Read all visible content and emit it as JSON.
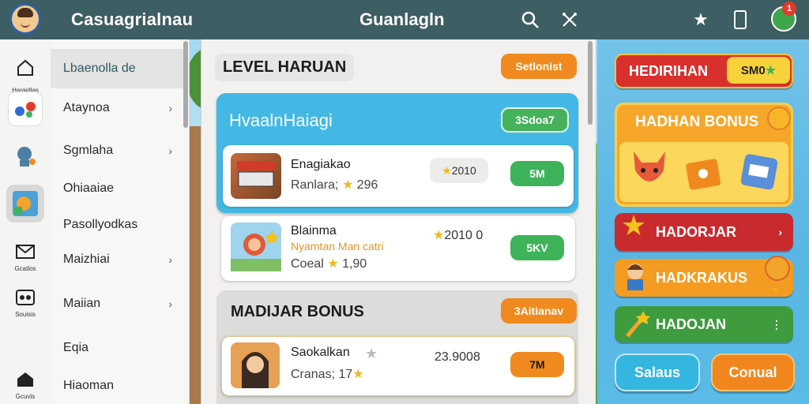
{
  "header": {
    "app_title": "Casuagrialnau",
    "center_title": "Guanlagln",
    "search_icon": "search-icon",
    "tools_icon": "crossed-tools-icon",
    "star_icon": "star-icon",
    "phone_icon": "phone-icon",
    "notification_badge": "1"
  },
  "rail": {
    "items": [
      {
        "icon": "home-icon",
        "label": "Haraidlas"
      },
      {
        "icon": "game-controller-icon",
        "label": ""
      },
      {
        "icon": "character-icon",
        "label": ""
      },
      {
        "icon": "map-icon",
        "label": ""
      },
      {
        "icon": "mail-icon",
        "label": "Gcatlos"
      },
      {
        "icon": "settings-icon",
        "label": "Souisis"
      },
      {
        "icon": "shop-icon",
        "label": "Gcuvis"
      }
    ]
  },
  "menu": {
    "items": [
      {
        "label": "Lbaenolla de",
        "chevron": false,
        "active": true
      },
      {
        "label": "Ataynoa",
        "chevron": true,
        "active": false
      },
      {
        "label": "Sgmlaha",
        "chevron": true,
        "active": false
      },
      {
        "label": "Ohiaaiae",
        "chevron": false,
        "active": false
      },
      {
        "label": "Pasollyodkas",
        "chevron": false,
        "active": false
      },
      {
        "label": "Maizhiai",
        "chevron": true,
        "active": false
      },
      {
        "label": "Maiian",
        "chevron": true,
        "active": false
      },
      {
        "label": "Eqia",
        "chevron": false,
        "active": false
      },
      {
        "label": "Hiaoman",
        "chevron": false,
        "active": false
      }
    ]
  },
  "main": {
    "level_section": {
      "title": "LEVEL HARUAN",
      "action": "Setlonist"
    },
    "highlight": {
      "title": "HvaalnHaiagi",
      "badge": "3Sdoa7"
    },
    "rows": [
      {
        "name": "Enagiakao",
        "sub": "Ranlara;",
        "sub_value": "296",
        "score": "2010",
        "action": "5M"
      },
      {
        "name": "Blainma",
        "sub2": "Nyamtan Man catri",
        "sub": "Coeal",
        "sub_value": "1,90",
        "score": "2010 0",
        "action": "5KV"
      }
    ],
    "bonus_section": {
      "title": "MADIJAR BONUS",
      "action": "3Aitianav"
    },
    "bonus_rows": [
      {
        "name": "Saokalkan",
        "sub": "Cranas;",
        "sub_value": "17",
        "score": "23.9008",
        "action": "7M"
      }
    ]
  },
  "right": {
    "hedirihan": {
      "label": "HEDIRIHAN",
      "badge": "SM0"
    },
    "bonus_box": {
      "title": "HADHAN BONUS"
    },
    "buttons": [
      {
        "label": "HADORJAR",
        "color": "#c92a2e"
      },
      {
        "label": "HADKRAKUS",
        "color": "#f39c21"
      },
      {
        "label": "HADOJAN",
        "color": "#3e9b3e"
      }
    ],
    "bottom": {
      "left": "Salaus",
      "right": "Conual"
    }
  },
  "colors": {
    "topbar": "#3d5e63",
    "accent_orange": "#f08a1e",
    "accent_green": "#3fb35a",
    "accent_blue": "#44b8e4"
  }
}
